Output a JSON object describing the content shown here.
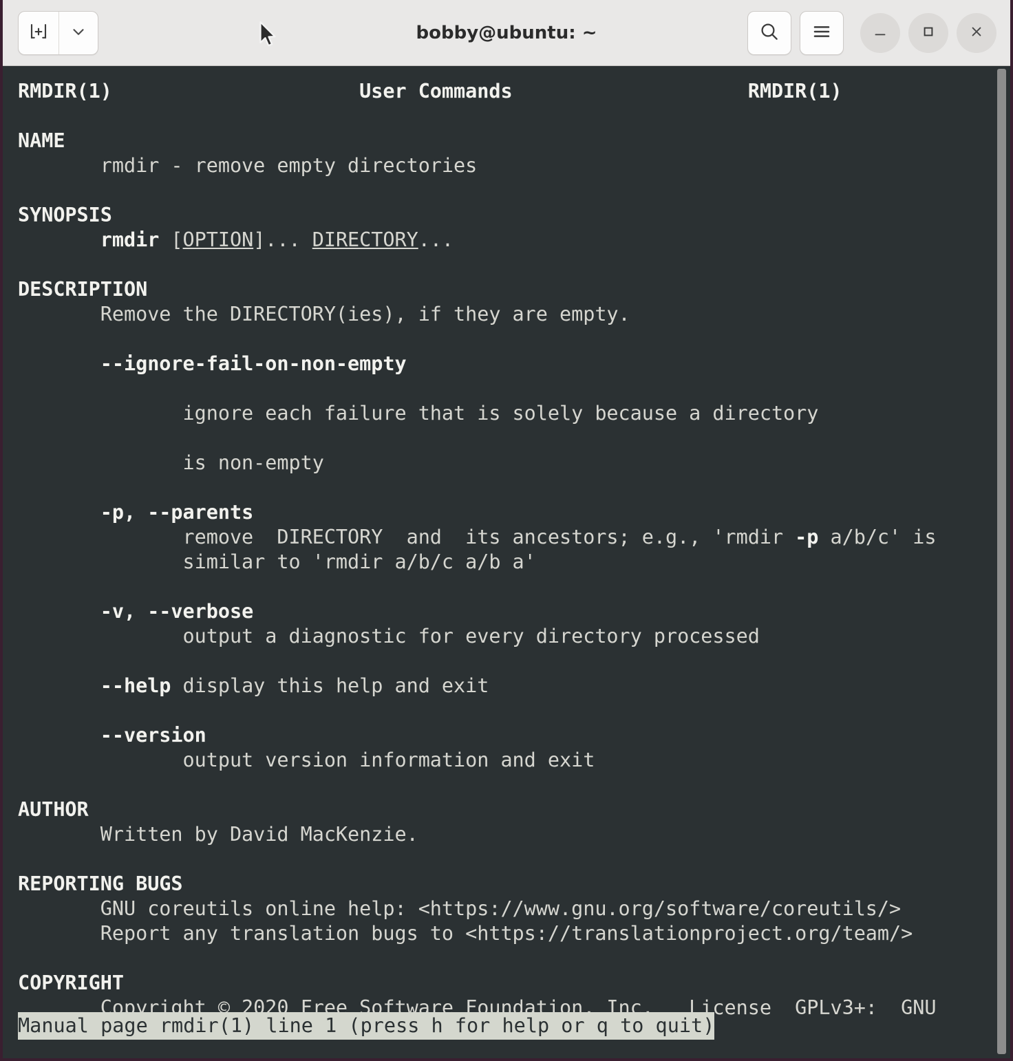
{
  "window": {
    "title": "bobby@ubuntu: ~",
    "frame_color": "#3a1f30",
    "titlebar_bg": "#e9e8e7",
    "terminal_bg": "#2b3133",
    "terminal_fg": "#d6d6d0"
  },
  "titlebar": {
    "new_tab_icon": "new-terminal-tab-icon",
    "new_tab_dropdown_icon": "chevron-down-icon",
    "search_icon": "search-icon",
    "menu_icon": "hamburger-menu-icon",
    "minimize_icon": "minimize-icon",
    "maximize_icon": "maximize-icon",
    "close_icon": "close-icon"
  },
  "manpage": {
    "header": {
      "left": "RMDIR(1)",
      "center": "User Commands",
      "right": "RMDIR(1)"
    },
    "sections": [
      {
        "heading": "NAME",
        "lines": [
          "rmdir - remove empty directories"
        ]
      },
      {
        "heading": "SYNOPSIS",
        "lines": [
          "rmdir [OPTION]... DIRECTORY..."
        ]
      },
      {
        "heading": "DESCRIPTION",
        "lines": [
          "Remove the DIRECTORY(ies), if they are empty.",
          "--ignore-fail-on-non-empty",
          "ignore each failure that is solely because a directory",
          "is non-empty",
          "-p, --parents",
          "remove  DIRECTORY  and  its ancestors; e.g., 'rmdir -p a/b/c' is",
          "similar to 'rmdir a/b/c a/b a'",
          "-v, --verbose",
          "output a diagnostic for every directory processed",
          "--help display this help and exit",
          "--version",
          "output version information and exit"
        ]
      },
      {
        "heading": "AUTHOR",
        "lines": [
          "Written by David MacKenzie."
        ]
      },
      {
        "heading": "REPORTING BUGS",
        "lines": [
          "GNU coreutils online help: <https://www.gnu.org/software/coreutils/>",
          "Report any translation bugs to <https://translationproject.org/team/>"
        ]
      },
      {
        "heading": "COPYRIGHT",
        "lines": [
          "Copyright © 2020 Free Software Foundation, Inc.   License  GPLv3+:  GNU"
        ]
      }
    ],
    "rendered_text": "RMDIR(1)                     User Commands                    RMDIR(1)\n\nNAME\n       rmdir - remove empty directories\n\nSYNOPSIS\n       rmdir [OPTION]... DIRECTORY...\n\nDESCRIPTION\n       Remove the DIRECTORY(ies), if they are empty.\n\n       --ignore-fail-on-non-empty\n\n              ignore each failure that is solely because a directory\n\n              is non-empty\n\n       -p, --parents\n              remove  DIRECTORY  and  its ancestors; e.g., 'rmdir -p a/b/c' is\n              similar to 'rmdir a/b/c a/b a'\n\n       -v, --verbose\n              output a diagnostic for every directory processed\n\n       --help display this help and exit\n\n       --version\n              output version information and exit\n\nAUTHOR\n       Written by David MacKenzie.\n\nREPORTING BUGS\n       GNU coreutils online help: <https://www.gnu.org/software/coreutils/>\n       Report any translation bugs to <https://translationproject.org/team/>\n\nCOPYRIGHT\n       Copyright © 2020 Free Software Foundation, Inc.   License  GPLv3+:  GNU"
  },
  "statusline": {
    "text": "Manual page rmdir(1) line 1 (press h for help or q to quit)",
    "bg": "#d4d7ce",
    "fg": "#2b3133"
  },
  "scrollbar": {
    "thumb_color": "#8d8d8d"
  }
}
